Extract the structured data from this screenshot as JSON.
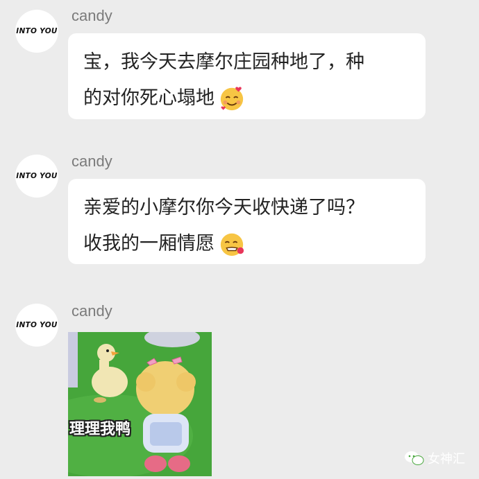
{
  "messages": [
    {
      "avatar_text": "INTO YOU",
      "sender": "candy",
      "lines": [
        "宝，我今天去摩尔庄园种地了，种",
        "的对你死心塌地"
      ],
      "emoji": "smiling-face-with-hearts-icon"
    },
    {
      "avatar_text": "INTO YOU",
      "sender": "candy",
      "lines": [
        "亲爱的小摩尔你今天收快递了吗？",
        "收我的一厢情愿"
      ],
      "emoji": "face-blowing-kiss-icon"
    },
    {
      "avatar_text": "INTO YOU",
      "sender": "candy",
      "sticker_caption": "理理我鸭"
    }
  ],
  "watermark": {
    "text": "女神汇",
    "icon": "wechat-icon"
  }
}
